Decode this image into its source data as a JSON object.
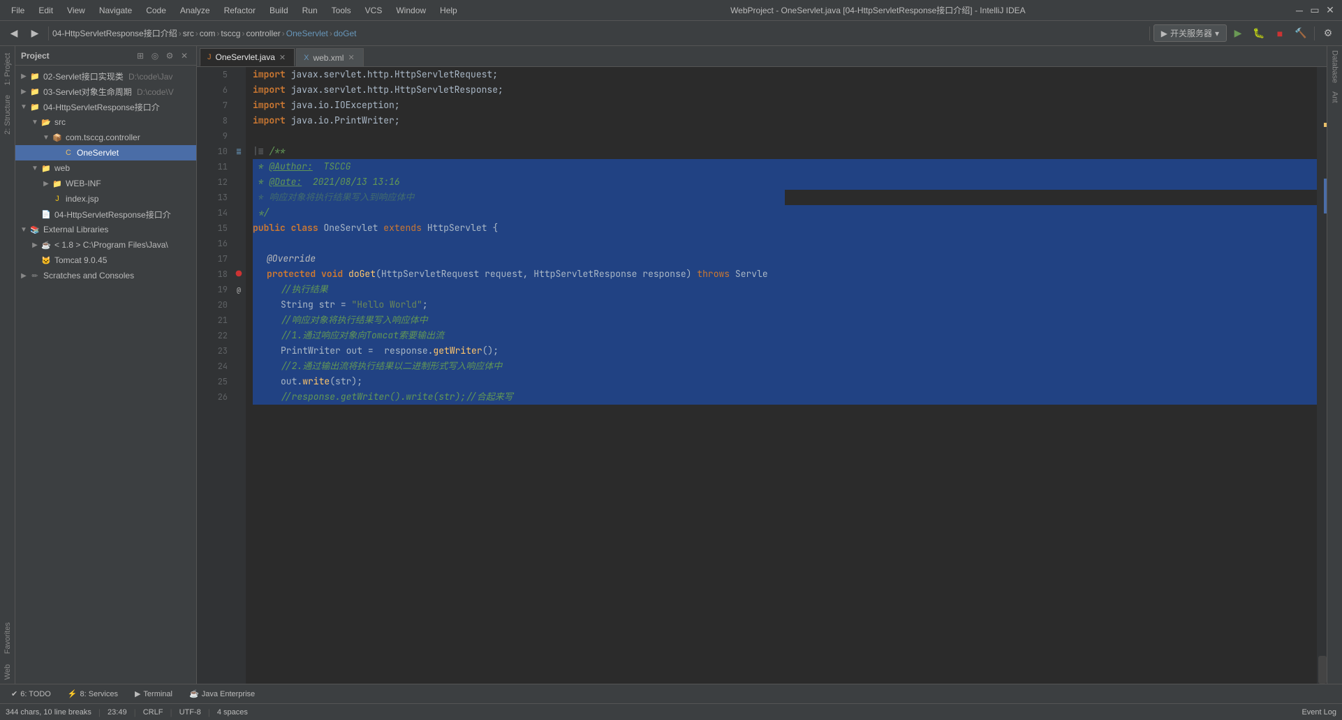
{
  "titleBar": {
    "title": "WebProject - OneServlet.java [04-HttpServletResponse接口介绍] - IntelliJ IDEA",
    "menuItems": [
      "File",
      "Edit",
      "View",
      "Navigate",
      "Code",
      "Analyze",
      "Refactor",
      "Build",
      "Run",
      "Tools",
      "VCS",
      "Window",
      "Help"
    ]
  },
  "toolbar": {
    "breadcrumbs": [
      "04-HttpServletResponse接口介绍",
      "src",
      "com",
      "tsccg",
      "controller",
      "OneServlet",
      "doGet"
    ],
    "serverBtn": "开关服务器"
  },
  "tabs": [
    {
      "label": "OneServlet.java",
      "type": "java",
      "active": true
    },
    {
      "label": "web.xml",
      "type": "xml",
      "active": false
    }
  ],
  "projectTree": {
    "title": "Project",
    "items": [
      {
        "indent": 0,
        "label": "02-Servlet接口实现类",
        "path": "D:\\code\\Jav",
        "expanded": true,
        "icon": "folder"
      },
      {
        "indent": 0,
        "label": "03-Servlet对象生命周期",
        "path": "D:\\code\\V",
        "expanded": false,
        "icon": "folder"
      },
      {
        "indent": 0,
        "label": "04-HttpServletResponse接口介",
        "expanded": true,
        "icon": "folder"
      },
      {
        "indent": 1,
        "label": "src",
        "expanded": true,
        "icon": "folder-src"
      },
      {
        "indent": 2,
        "label": "com.tsccg.controller",
        "expanded": true,
        "icon": "package"
      },
      {
        "indent": 3,
        "label": "OneServlet",
        "expanded": false,
        "icon": "class",
        "selected": true
      },
      {
        "indent": 1,
        "label": "web",
        "expanded": true,
        "icon": "folder"
      },
      {
        "indent": 2,
        "label": "WEB-INF",
        "expanded": false,
        "icon": "folder"
      },
      {
        "indent": 2,
        "label": "index.jsp",
        "icon": "jsp"
      },
      {
        "indent": 1,
        "label": "04-HttpServletResponse接口介",
        "icon": "file"
      },
      {
        "indent": 0,
        "label": "External Libraries",
        "expanded": true,
        "icon": "folder"
      },
      {
        "indent": 1,
        "label": "< 1.8 >  C:\\Program Files\\Java\\",
        "icon": "sdk"
      },
      {
        "indent": 1,
        "label": "Tomcat 9.0.45",
        "icon": "server"
      },
      {
        "indent": 0,
        "label": "Scratches and Consoles",
        "icon": "scratches"
      }
    ]
  },
  "code": {
    "lines": [
      {
        "num": 5,
        "content": "import javax.servlet.http.HttpServletRequest;",
        "selected": false
      },
      {
        "num": 6,
        "content": "import javax.servlet.http.HttpServletResponse;",
        "selected": false
      },
      {
        "num": 7,
        "content": "import java.io.IOException;",
        "selected": false
      },
      {
        "num": 8,
        "content": "import java.io.PrintWriter;",
        "selected": false
      },
      {
        "num": 9,
        "content": "",
        "selected": false
      },
      {
        "num": 10,
        "content": "/**",
        "selected": false,
        "hasGutter": "bookmark"
      },
      {
        "num": 11,
        "content": " * @Author: TSCCG",
        "selected": true
      },
      {
        "num": 12,
        "content": " * @Date: 2021/08/13 13:16",
        "selected": true
      },
      {
        "num": 13,
        "content": " * 响应对象将执行结果写入到响应体中",
        "selected": true,
        "partialEnd": true
      },
      {
        "num": 14,
        "content": " */",
        "selected": true
      },
      {
        "num": 15,
        "content": "public class OneServlet extends HttpServlet {",
        "selected": true
      },
      {
        "num": 16,
        "content": "",
        "selected": true
      },
      {
        "num": 17,
        "content": "    @Override",
        "selected": true
      },
      {
        "num": 18,
        "content": "    protected void doGet(HttpServletRequest request, HttpServletResponse response) throws Servle",
        "selected": true,
        "hasGutter": "breakpoint"
      },
      {
        "num": 19,
        "content": "        //执行结果",
        "selected": true
      },
      {
        "num": 20,
        "content": "        String str = \"Hello World\";",
        "selected": true
      },
      {
        "num": 21,
        "content": "        //响应对象将执行结果写入响应体中",
        "selected": true
      },
      {
        "num": 22,
        "content": "        //1.通过响应对象向Tomcat索要输出流",
        "selected": true
      },
      {
        "num": 23,
        "content": "        PrintWriter out =  response.getWriter();",
        "selected": true
      },
      {
        "num": 24,
        "content": "        //2.通过输出流将执行结果以二进制形式写入响应体中",
        "selected": true
      },
      {
        "num": 25,
        "content": "        out.write(str);",
        "selected": true
      },
      {
        "num": 26,
        "content": "        //response.getWriter().write(str);//合起来写",
        "selected": true
      }
    ]
  },
  "statusBar": {
    "todo": "6: TODO",
    "services": "8: Services",
    "terminal": "Terminal",
    "javaEnterprise": "Java Enterprise",
    "chars": "344 chars, 10 line breaks",
    "position": "23:49",
    "lineEnding": "CRLF",
    "encoding": "UTF-8",
    "indent": "4 spaces",
    "eventLog": "Event Log"
  },
  "rightStrip": {
    "tabs": [
      "Database",
      "Ant"
    ]
  },
  "leftStrip": {
    "tabs": [
      "1: Project",
      "2: Structure",
      "Favorites",
      "Web"
    ]
  }
}
